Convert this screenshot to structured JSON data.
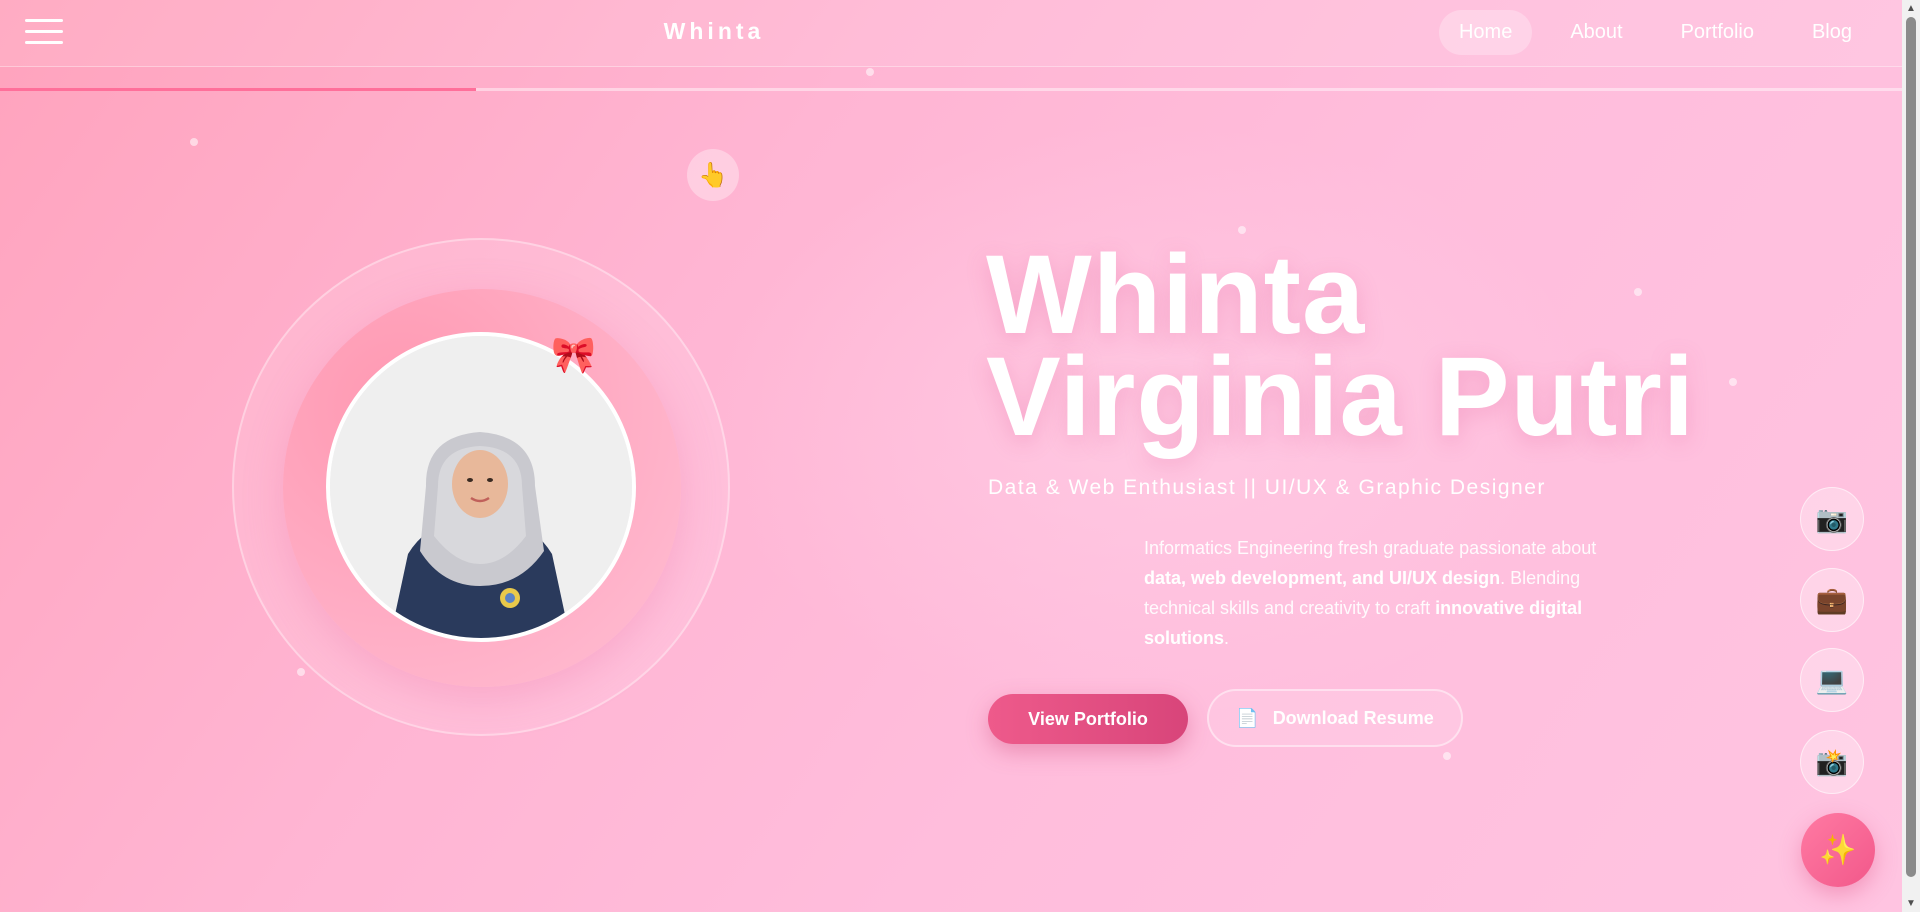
{
  "nav": {
    "brand": "Whinta",
    "links": [
      {
        "label": "Home",
        "active": true
      },
      {
        "label": "About",
        "active": false
      },
      {
        "label": "Portfolio",
        "active": false
      },
      {
        "label": "Blog",
        "active": false
      }
    ],
    "scroll_progress": 0.25
  },
  "hero": {
    "name_line1": "Whinta",
    "name_line2": "Virginia Putri",
    "subtitle": "Data & Web Enthusiast || UI/UX & Graphic Designer",
    "description": {
      "p1": "Informatics Engineering fresh graduate passionate about ",
      "b1": "data, web development, and UI/UX design",
      "p2": ". Blending technical skills and creativity to craft ",
      "b2": "innovative digital solutions",
      "p3": "."
    },
    "primary_button": "View Portfolio",
    "secondary_button": "Download Resume"
  },
  "icons": {
    "pointer": "👆",
    "bow": "🎀",
    "document": "📄",
    "camera": "📷",
    "briefcase": "💼",
    "laptop": "💻",
    "photo_camera": "📸",
    "sparkles": "✨"
  },
  "colors": {
    "accent": "#ee5a8b",
    "progress": "#ff6f9a",
    "background": "#ffb5d3"
  }
}
